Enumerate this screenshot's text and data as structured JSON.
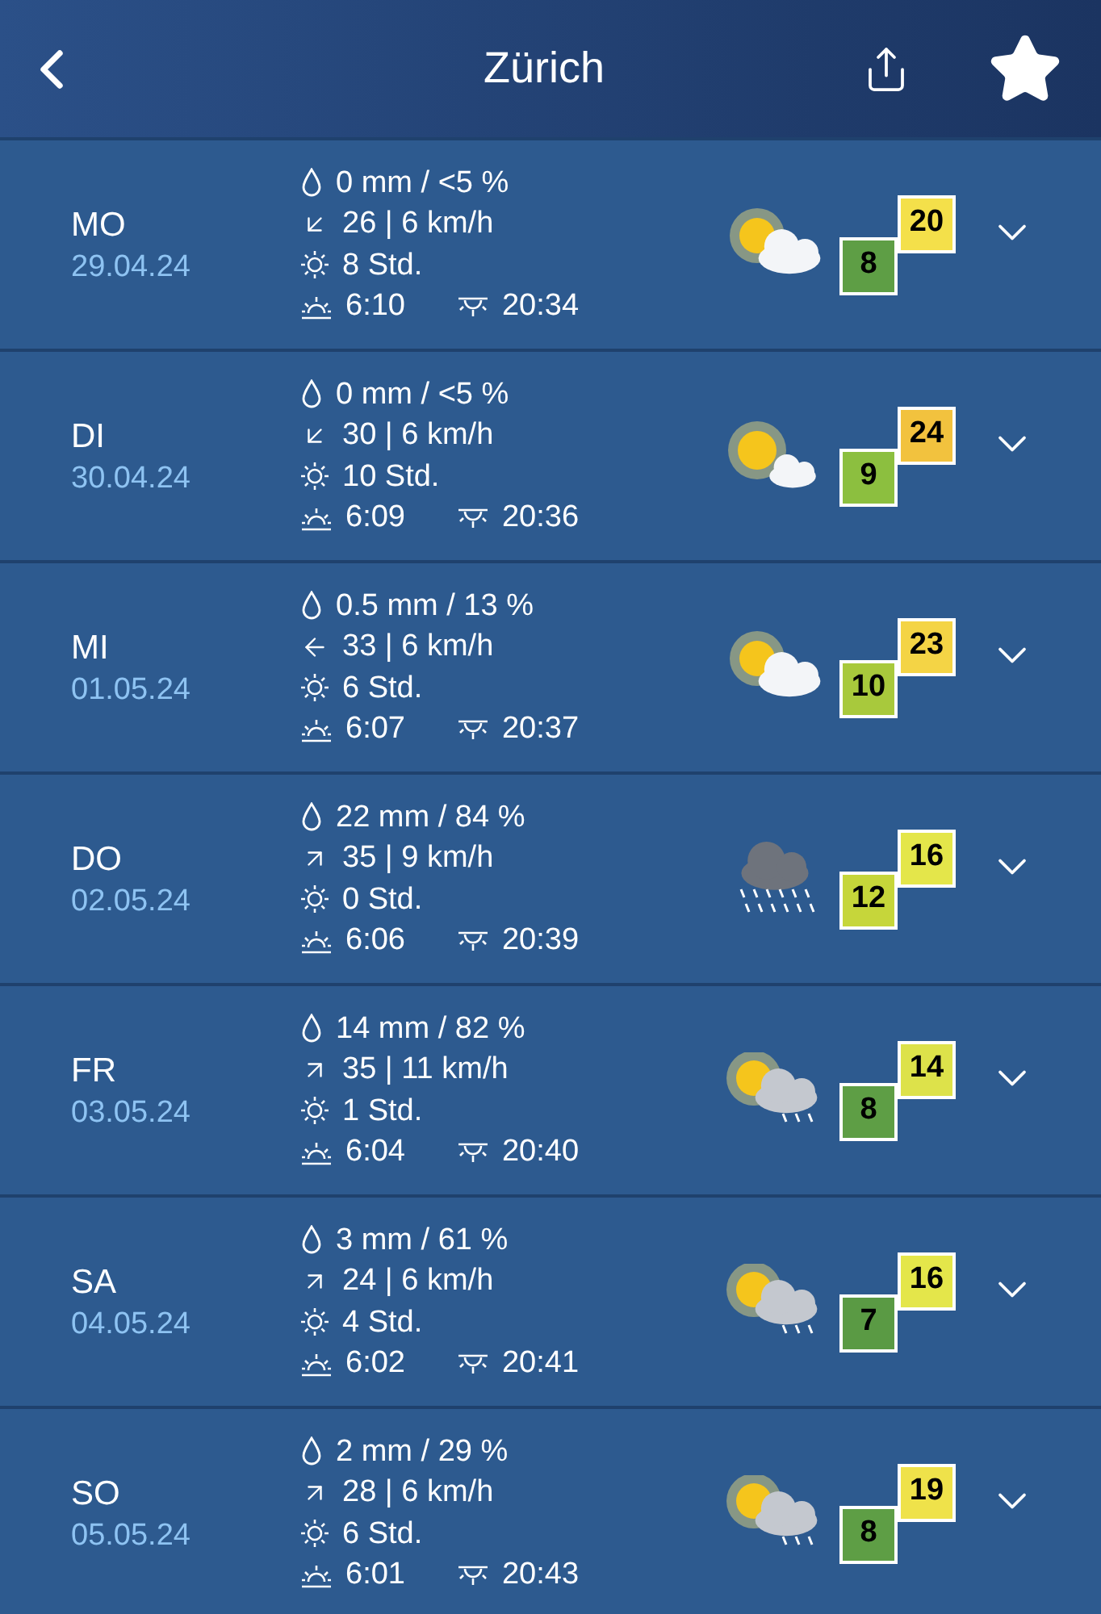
{
  "header": {
    "title": "Zürich"
  },
  "days": [
    {
      "day": "MO",
      "date": "29.04.24",
      "precip": "0 mm / <5 %",
      "wind_icon": {
        "kind": "sw"
      },
      "wind": "26 | 6 km/h",
      "sun_hours": "8 Std.",
      "sunrise": "6:10",
      "sunset": "20:34",
      "weather_icon": {
        "kind": "sun-cloud"
      },
      "min": {
        "value": "8",
        "color": "#5e9e45"
      },
      "max": {
        "value": "20",
        "color": "#f4e04a"
      }
    },
    {
      "day": "DI",
      "date": "30.04.24",
      "precip": "0 mm / <5 %",
      "wind_icon": {
        "kind": "sw"
      },
      "wind": "30 | 6 km/h",
      "sun_hours": "10 Std.",
      "sunrise": "6:09",
      "sunset": "20:36",
      "weather_icon": {
        "kind": "sun-small-cloud"
      },
      "min": {
        "value": "9",
        "color": "#8cbf3f"
      },
      "max": {
        "value": "24",
        "color": "#f2c23e"
      }
    },
    {
      "day": "MI",
      "date": "01.05.24",
      "precip": "0.5 mm / 13 %",
      "wind_icon": {
        "kind": "w"
      },
      "wind": "33 | 6 km/h",
      "sun_hours": "6 Std.",
      "sunrise": "6:07",
      "sunset": "20:37",
      "weather_icon": {
        "kind": "sun-cloud"
      },
      "min": {
        "value": "10",
        "color": "#a8c93c"
      },
      "max": {
        "value": "23",
        "color": "#f4d445"
      }
    },
    {
      "day": "DO",
      "date": "02.05.24",
      "precip": "22 mm / 84 %",
      "wind_icon": {
        "kind": "ne"
      },
      "wind": "35 | 9 km/h",
      "sun_hours": "0 Std.",
      "sunrise": "6:06",
      "sunset": "20:39",
      "weather_icon": {
        "kind": "rain"
      },
      "min": {
        "value": "12",
        "color": "#c6d63a"
      },
      "max": {
        "value": "16",
        "color": "#e4e64a"
      }
    },
    {
      "day": "FR",
      "date": "03.05.24",
      "precip": "14 mm / 82 %",
      "wind_icon": {
        "kind": "ne"
      },
      "wind": "35 | 11 km/h",
      "sun_hours": "1 Std.",
      "sunrise": "6:04",
      "sunset": "20:40",
      "weather_icon": {
        "kind": "sun-rain"
      },
      "min": {
        "value": "8",
        "color": "#5e9e45"
      },
      "max": {
        "value": "14",
        "color": "#dde24a"
      }
    },
    {
      "day": "SA",
      "date": "04.05.24",
      "precip": "3 mm / 61 %",
      "wind_icon": {
        "kind": "ne"
      },
      "wind": "24 | 6 km/h",
      "sun_hours": "4 Std.",
      "sunrise": "6:02",
      "sunset": "20:41",
      "weather_icon": {
        "kind": "sun-rain"
      },
      "min": {
        "value": "7",
        "color": "#5a9a44"
      },
      "max": {
        "value": "16",
        "color": "#e4e64a"
      }
    },
    {
      "day": "SO",
      "date": "05.05.24",
      "precip": "2 mm / 29 %",
      "wind_icon": {
        "kind": "ne"
      },
      "wind": "28 | 6 km/h",
      "sun_hours": "6 Std.",
      "sunrise": "6:01",
      "sunset": "20:43",
      "weather_icon": {
        "kind": "sun-rain"
      },
      "min": {
        "value": "8",
        "color": "#5e9e45"
      },
      "max": {
        "value": "19",
        "color": "#efe24a"
      }
    }
  ]
}
